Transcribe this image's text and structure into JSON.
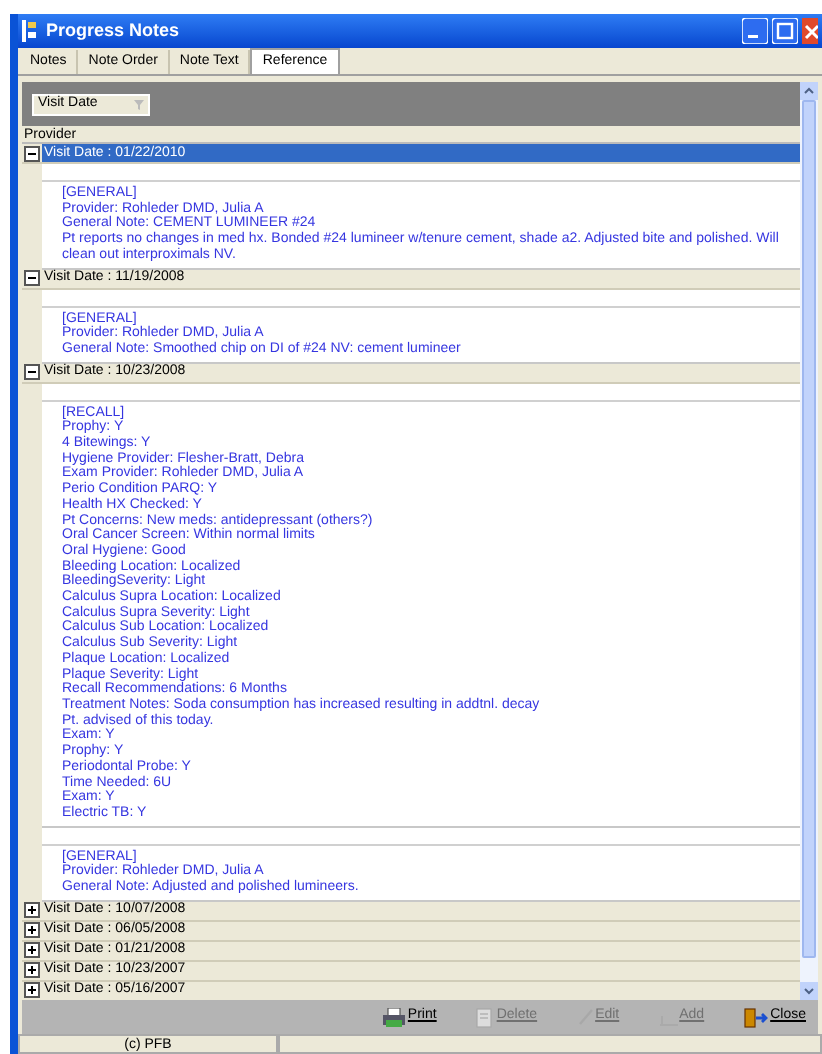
{
  "window": {
    "title": "Progress Notes"
  },
  "tabs": [
    {
      "label": "Notes",
      "selected": false
    },
    {
      "label": "Note Order",
      "selected": false
    },
    {
      "label": "Note Text",
      "selected": false
    },
    {
      "label": "Reference",
      "selected": true
    }
  ],
  "group_by": {
    "label": "Visit Date"
  },
  "column_header": "Provider",
  "groups": [
    {
      "label": "Visit Date : 01/22/2010",
      "expanded": true,
      "selected": true,
      "notes": [
        [
          "[GENERAL]",
          "Provider:  Rohleder DMD, Julia A",
          "General Note: CEMENT LUMINEER #24",
          "Pt reports no changes in med hx.  Bonded #24 lumineer w/tenure cement, shade a2.  Adjusted bite and polished.  Will clean out interproximals NV."
        ]
      ]
    },
    {
      "label": "Visit Date : 11/19/2008",
      "expanded": true,
      "selected": false,
      "notes": [
        [
          "[GENERAL]",
          "Provider:  Rohleder DMD, Julia A",
          "General Note: Smoothed chip on DI of #24  NV:  cement lumineer"
        ]
      ]
    },
    {
      "label": "Visit Date : 10/23/2008",
      "expanded": true,
      "selected": false,
      "notes": [
        [
          "[RECALL]",
          "Prophy:  Y",
          "4 Bitewings:  Y",
          "Hygiene Provider:  Flesher-Bratt, Debra",
          "Exam Provider:  Rohleder DMD, Julia A",
          "Perio Condition PARQ:  Y",
          "Health HX Checked:  Y",
          "Pt Concerns:  New meds: antidepressant (others?)",
          "Oral Cancer Screen:  Within normal limits",
          "Oral Hygiene:  Good",
          "Bleeding Location:  Localized",
          "BleedingSeverity:  Light",
          "Calculus Supra Location:  Localized",
          "Calculus Supra Severity:  Light",
          "Calculus Sub Location:  Localized",
          "Calculus Sub Severity:  Light",
          "Plaque Location:  Localized",
          "Plaque Severity:  Light",
          "Recall Recommendations:  6 Months",
          "Treatment Notes: Soda consumption has increased resulting in addtnl. decay",
          "Pt. advised of this today.",
          "Exam:  Y",
          "Prophy:  Y",
          "Periodontal Probe:  Y",
          "Time Needed:  6U",
          "Exam:  Y",
          "Electric TB:  Y"
        ],
        [
          "[GENERAL]",
          "Provider:  Rohleder DMD, Julia A",
          "General Note: Adjusted and polished lumineers."
        ]
      ]
    },
    {
      "label": "Visit Date : 10/07/2008",
      "expanded": false,
      "selected": false
    },
    {
      "label": "Visit Date : 06/05/2008",
      "expanded": false,
      "selected": false
    },
    {
      "label": "Visit Date : 01/21/2008",
      "expanded": false,
      "selected": false
    },
    {
      "label": "Visit Date : 10/23/2007",
      "expanded": false,
      "selected": false
    },
    {
      "label": "Visit Date : 05/16/2007",
      "expanded": false,
      "selected": false
    }
  ],
  "buttons": [
    {
      "label": "Print",
      "kind": "print",
      "disabled": false
    },
    {
      "label": "Delete",
      "kind": "delete",
      "disabled": true
    },
    {
      "label": "Edit",
      "kind": "edit",
      "disabled": true
    },
    {
      "label": "Add",
      "kind": "add",
      "disabled": true
    },
    {
      "label": "Close",
      "kind": "close",
      "disabled": false
    }
  ],
  "status_bar": {
    "text": "(c) PFB"
  }
}
